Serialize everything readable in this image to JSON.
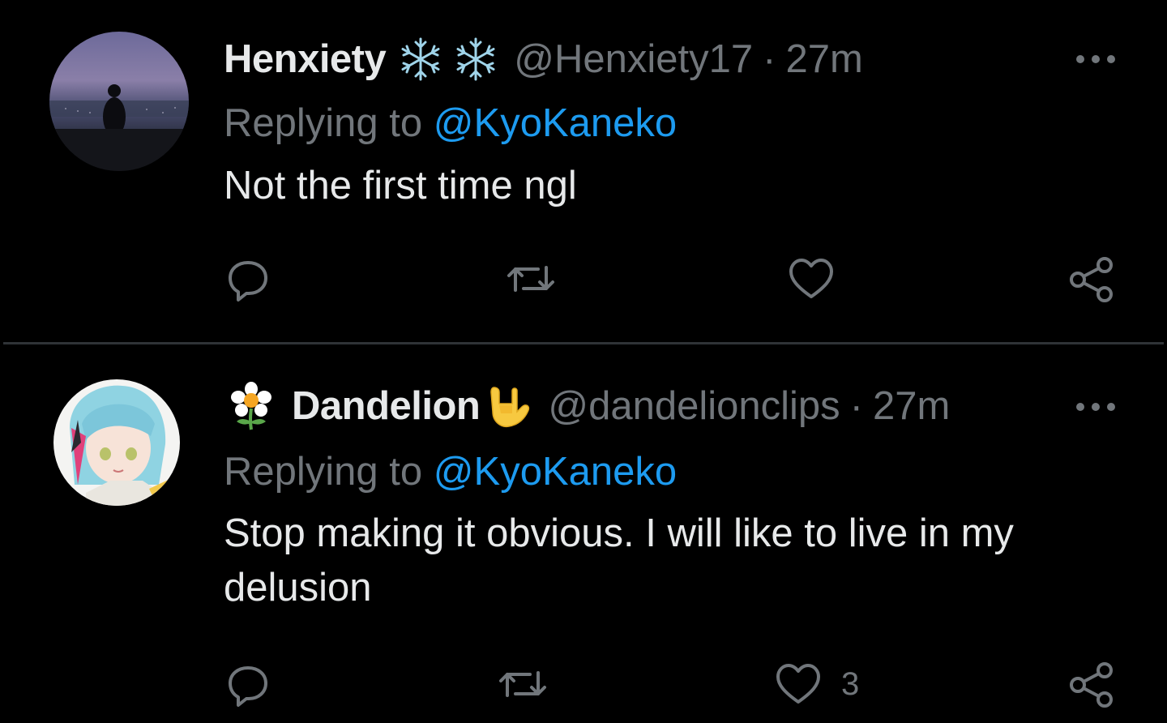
{
  "tweets": [
    {
      "display_name": "Henxiety",
      "name_emojis": [
        "snowflake-icon",
        "snowflake-icon"
      ],
      "handle": "@Henxiety17",
      "separator": "·",
      "time": "27m",
      "replying_prefix": "Replying to",
      "replying_to": "@KyoKaneko",
      "text": "Not the first time ngl",
      "actions": {
        "reply_count": "",
        "retweet_count": "",
        "like_count": ""
      }
    },
    {
      "display_name": "Dandelion",
      "name_emojis": [
        "flower-icon",
        "rock-hand-icon"
      ],
      "handle": "@dandelionclips",
      "separator": "·",
      "time": "27m",
      "replying_prefix": "Replying to",
      "replying_to": "@KyoKaneko",
      "text": "Stop making it obvious. I will like to live in my delusion",
      "actions": {
        "reply_count": "",
        "retweet_count": "",
        "like_count": "3"
      }
    }
  ],
  "colors": {
    "background": "#000000",
    "text_primary": "#e7e9ea",
    "text_secondary": "#71767b",
    "accent": "#1d9bf0",
    "divider": "#2f3336"
  }
}
